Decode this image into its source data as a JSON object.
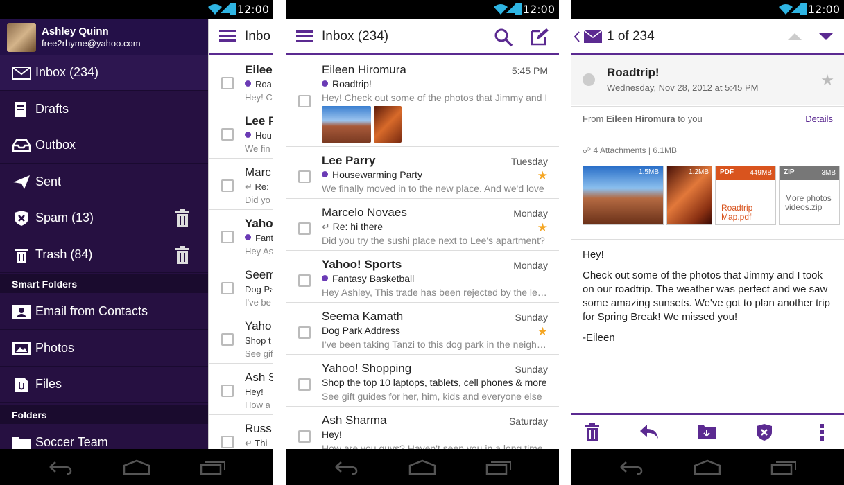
{
  "status": {
    "time": "12:00"
  },
  "drawer": {
    "account_name": "Ashley Quinn",
    "account_email": "free2rhyme@yahoo.com",
    "items": [
      {
        "label": "Inbox (234)",
        "icon": "envelope-icon"
      },
      {
        "label": "Drafts",
        "icon": "drafts-icon"
      },
      {
        "label": "Outbox",
        "icon": "outbox-icon"
      },
      {
        "label": "Sent",
        "icon": "sent-icon"
      },
      {
        "label": "Spam (13)",
        "icon": "spam-shield-icon"
      },
      {
        "label": "Trash (84)",
        "icon": "trash-icon"
      }
    ],
    "smart_folders_header": "Smart Folders",
    "smart_folders": [
      {
        "label": "Email from Contacts",
        "icon": "contacts-icon"
      },
      {
        "label": "Photos",
        "icon": "photos-icon"
      },
      {
        "label": "Files",
        "icon": "files-icon"
      }
    ],
    "folders_header": "Folders",
    "folders": [
      {
        "label": "Soccer Team",
        "icon": "folder-icon"
      }
    ]
  },
  "peek": {
    "title": "Inbo",
    "rows": [
      {
        "t": "Eileer",
        "s": "Roa",
        "p": "Hey! C"
      },
      {
        "t": "Lee P",
        "s": "Hou",
        "p": "We fin"
      },
      {
        "t": "Marc",
        "s": "Re:",
        "p": "Did yo"
      },
      {
        "t": "Yaho",
        "s": "Fant",
        "p": "Hey As"
      },
      {
        "t": "Seem",
        "s": "Dog Pa",
        "p": "I've be"
      },
      {
        "t": "Yaho",
        "s": "Shop t",
        "p": "See gif"
      },
      {
        "t": "Ash S",
        "s": "Hey!",
        "p": "How a"
      },
      {
        "t": "Russ",
        "s": "Thi",
        "p": ""
      }
    ]
  },
  "inbox": {
    "title": "Inbox (234)",
    "messages": [
      {
        "sender": "Eileen Hiromura",
        "date": "5:45 PM",
        "subject": "Roadtrip!",
        "preview": "Hey! Check out some of the photos that Jimmy and I",
        "unread": true,
        "starred": false,
        "bold": false
      },
      {
        "sender": "Lee Parry",
        "date": "Tuesday",
        "subject": "Housewarming Party",
        "preview": "We finally moved in to the new place. And we'd love",
        "unread": true,
        "starred": true,
        "bold": true
      },
      {
        "sender": "Marcelo Novaes",
        "date": "Monday",
        "subject": "Re: hi there",
        "preview": "Did you try the sushi place next to Lee's apartment?",
        "unread": false,
        "starred": true,
        "bold": false
      },
      {
        "sender": "Yahoo! Sports",
        "date": "Monday",
        "subject": "Fantasy Basketball",
        "preview": "Hey Ashley, This trade has been rejected by the league",
        "unread": true,
        "starred": false,
        "bold": true
      },
      {
        "sender": "Seema Kamath",
        "date": "Sunday",
        "subject": "Dog Park Address",
        "preview": "I've been taking Tanzi to this dog park in the neighborhood",
        "unread": false,
        "starred": true,
        "bold": false
      },
      {
        "sender": "Yahoo! Shopping",
        "date": "Sunday",
        "subject": "Shop the top 10 laptops, tablets, cell phones & more",
        "preview": "See gift guides for her, him, kids and everyone else",
        "unread": false,
        "starred": false,
        "bold": false
      },
      {
        "sender": "Ash Sharma",
        "date": "Saturday",
        "subject": "Hey!",
        "preview": "How are you guys? Haven't seen you in a long time",
        "unread": false,
        "starred": false,
        "bold": false
      }
    ]
  },
  "message": {
    "position": "1 of 234",
    "subject": "Roadtrip!",
    "date": "Wednesday, Nov 28, 2012 at 5:45 PM",
    "from_prefix": "From",
    "from_name": "Eileen Hiromura",
    "from_suffix": "to you",
    "details_label": "Details",
    "attachments_label": "4 Attachments",
    "attachments_size": "6.1MB",
    "attachments": [
      {
        "type": "image",
        "size": "1.5MB"
      },
      {
        "type": "image",
        "size": "1.2MB"
      },
      {
        "type": "PDF",
        "size": "449MB",
        "name": "Roadtrip Map.pdf"
      },
      {
        "type": "ZIP",
        "size": "3MB",
        "name": "More photos videos.zip"
      }
    ],
    "body": [
      "Hey!",
      "Check out some of the photos that Jimmy and I took on our roadtrip. The weather was perfect and we saw some amazing sunsets. We've got to plan another trip for Spring Break! We missed you!",
      "-Eileen"
    ]
  },
  "colors": {
    "brand": "#5b2a91",
    "drawer": "#261041",
    "star": "#f5a623",
    "pdf": "#d9541e"
  }
}
